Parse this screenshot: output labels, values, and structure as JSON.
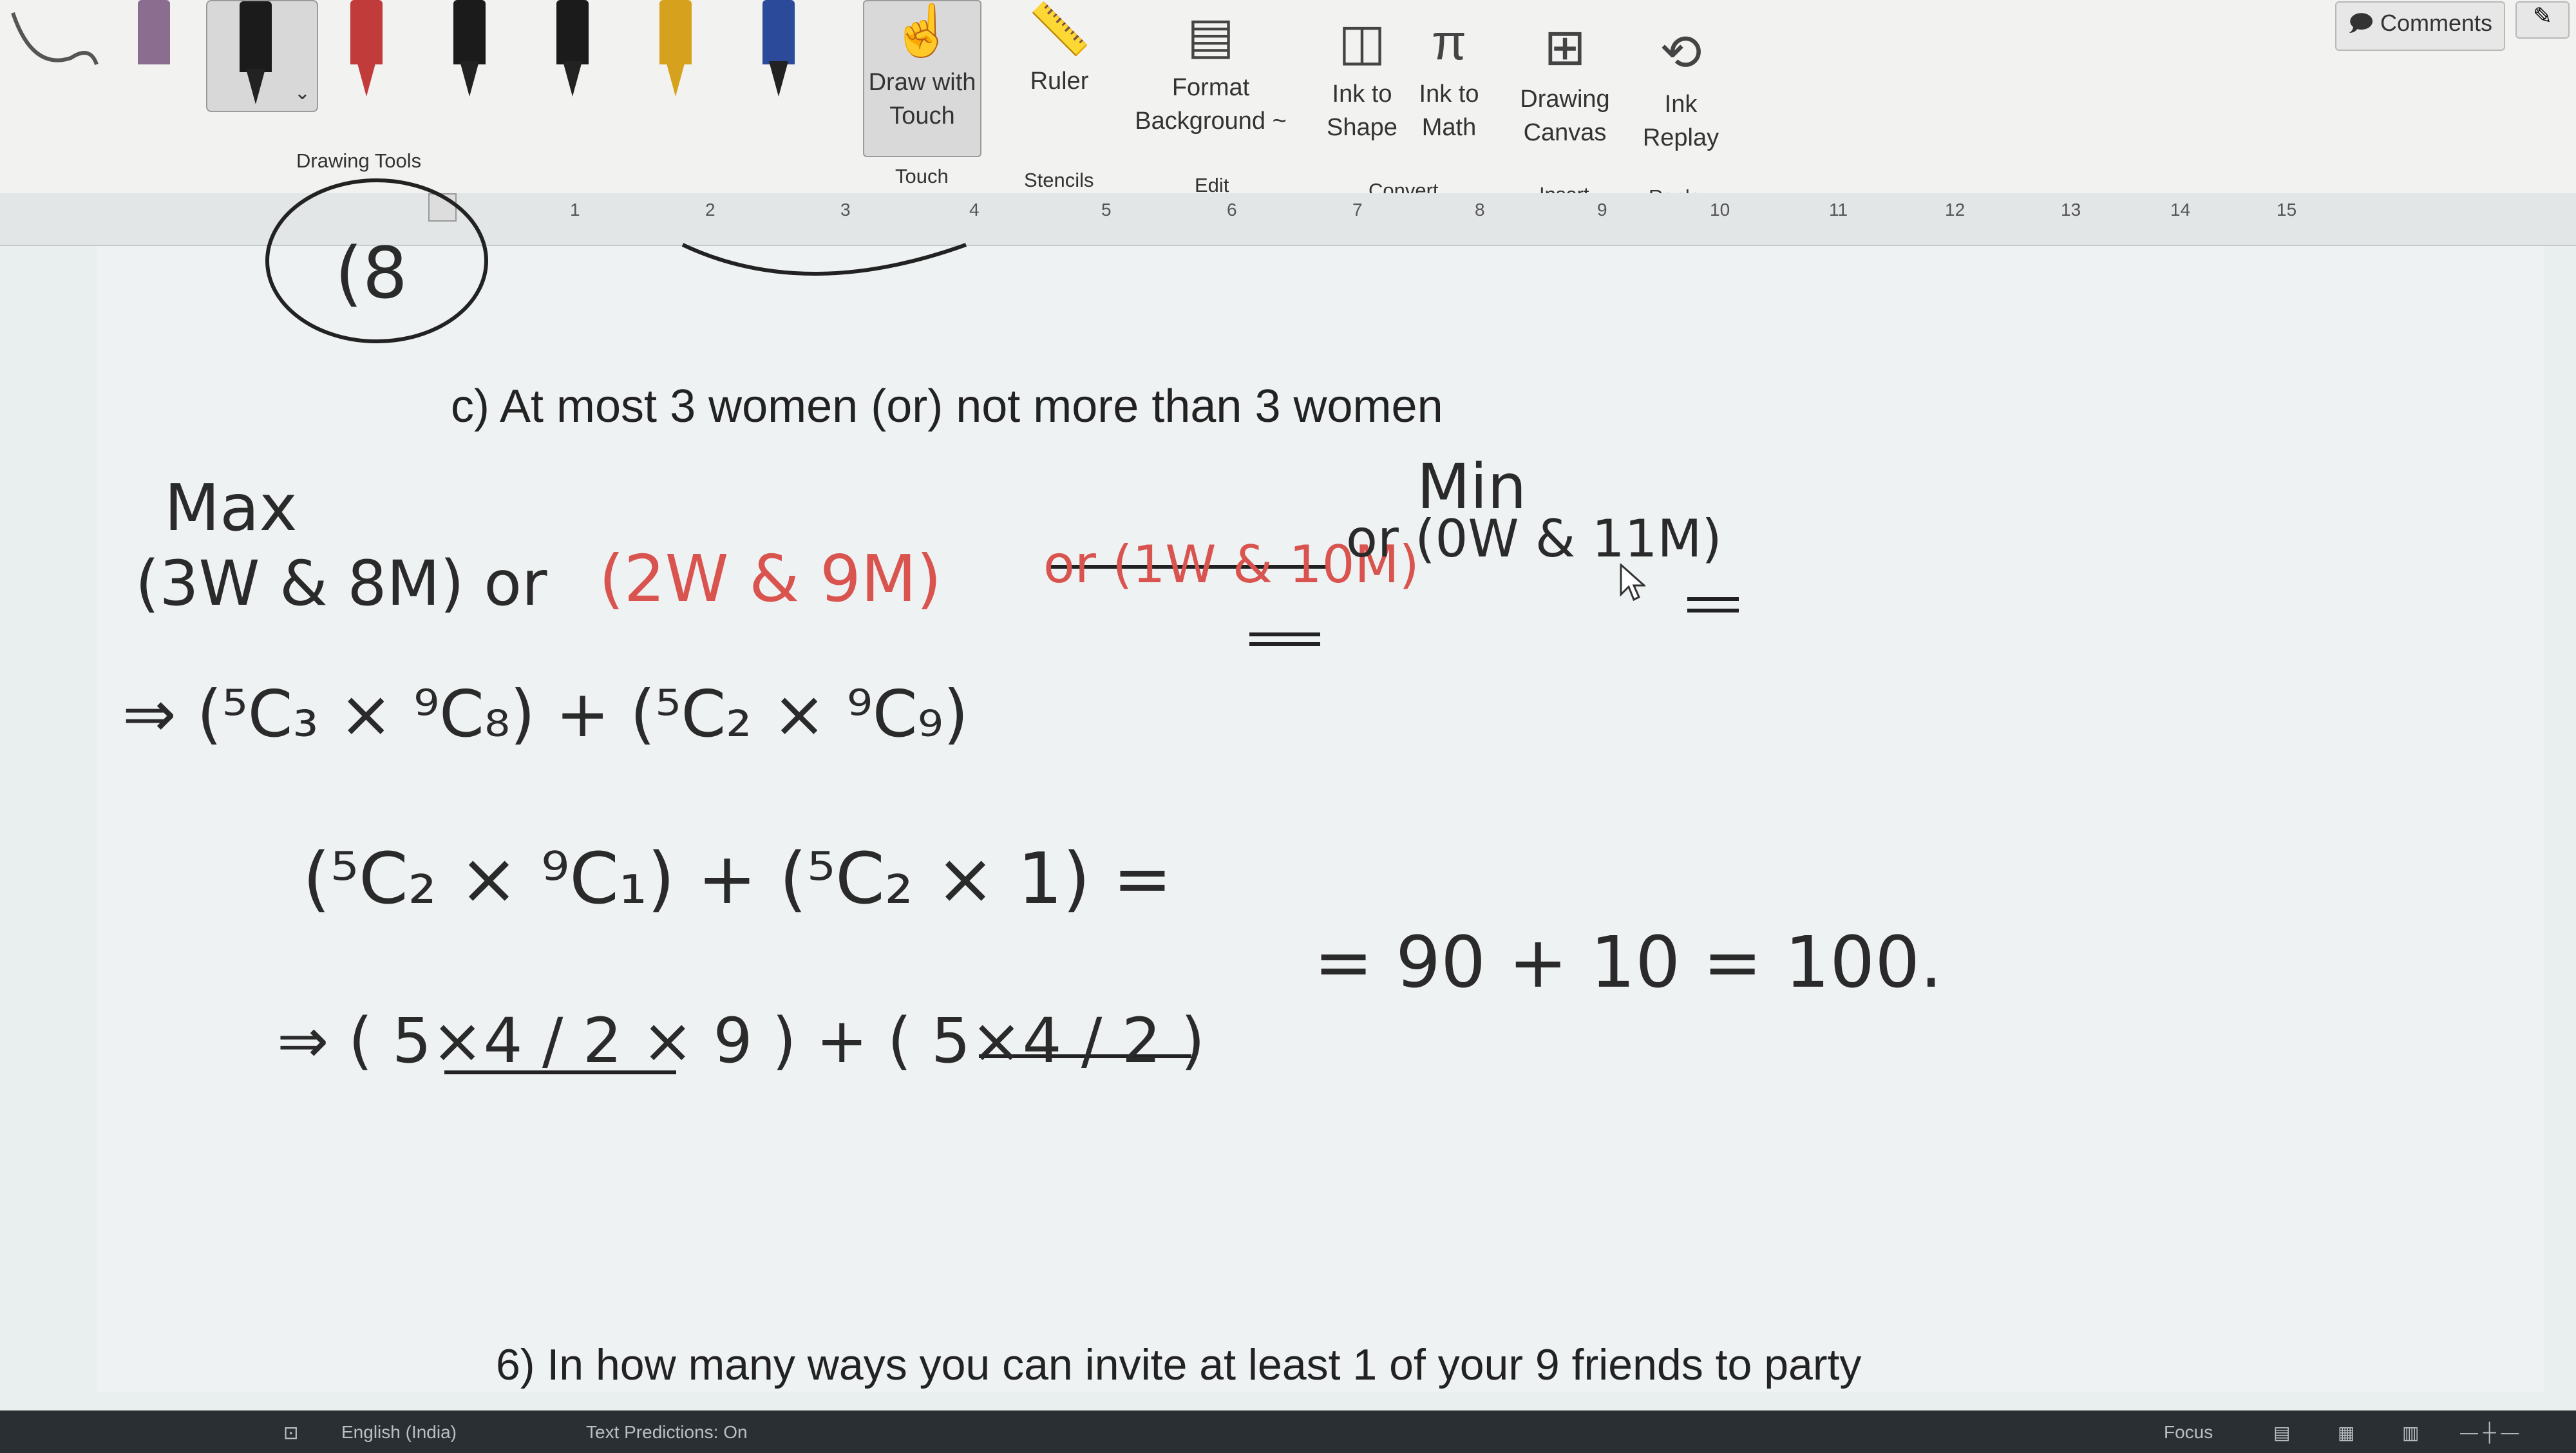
{
  "ribbon": {
    "groups": {
      "drawing_tools": "Drawing Tools",
      "touch": "Touch",
      "stencils": "Stencils",
      "edit": "Edit",
      "convert": "Convert",
      "insert": "Insert",
      "replay": "Replay"
    },
    "buttons": {
      "draw_with_touch": "Draw with Touch",
      "ruler": "Ruler",
      "format_background": "Format Background ~",
      "ink_to_shape": "Ink to Shape",
      "ink_to_math": "Ink to Math",
      "drawing_canvas": "Drawing Canvas",
      "ink_replay": "Ink Replay"
    },
    "comments": "Comments",
    "pen_colors": [
      "#555555",
      "#8a6d8f",
      "#1b1b1b",
      "#c23b3b",
      "#1b1b1b",
      "#1b1b1b",
      "#d6a21e",
      "#2b4a9a"
    ]
  },
  "ruler": {
    "numbers": [
      "1",
      "2",
      "3",
      "4",
      "5",
      "6",
      "7",
      "8",
      "9",
      "10",
      "11",
      "12",
      "13",
      "14",
      "15"
    ]
  },
  "document": {
    "question_c": "c) At most 3 women (or) not more than 3 women",
    "question_6": "6) In how many ways you can invite at least 1 of your 9 friends to party",
    "ink": {
      "fragment_top": "(8",
      "max": "Max",
      "min": "Min",
      "case_black_1": "(3W & 8M) or",
      "case_red": "(2W & 9M)",
      "case_red_strike": "or (1W & 10M)",
      "case_black_2": "or (0W & 11M)",
      "line_1": "⇒ (⁵C₃ × ⁹C₈) + (⁵C₂ × ⁹C₉)",
      "line_2": "(⁵C₂ × ⁹C₁) + (⁵C₂ × 1) =",
      "line_3": "⇒ ( 5×4 / 2 × 9 ) + ( 5×4 / 2 )",
      "result": "= 90 + 10 = 100."
    }
  },
  "statusbar": {
    "language": "English (India)",
    "text_predictions": "Text Predictions: On",
    "focus": "Focus"
  }
}
